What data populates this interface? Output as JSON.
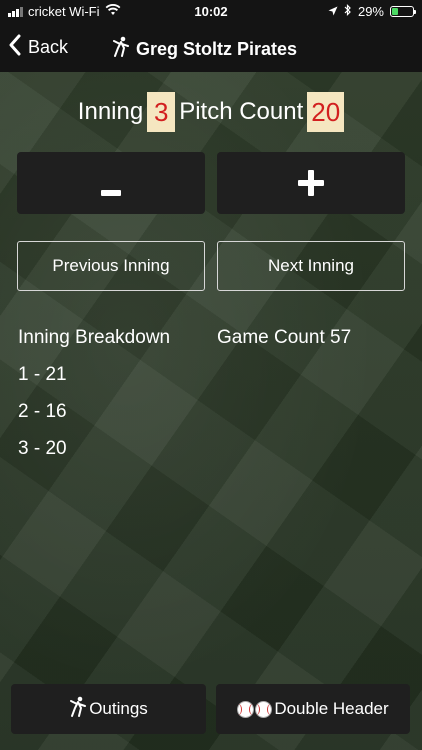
{
  "status_bar": {
    "carrier": "cricket Wi-Fi",
    "time": "10:02",
    "battery": "29%",
    "battery_fraction": 0.29,
    "icons": [
      "signal-bars-icon",
      "wifi-icon",
      "location-icon",
      "bluetooth-icon",
      "battery-icon"
    ]
  },
  "nav": {
    "back_label": "Back",
    "title": "Greg Stoltz Pirates",
    "title_icon": "pitcher-icon"
  },
  "counter": {
    "inning_label": "Inning",
    "inning_value": "3",
    "pitch_count_label": "Pitch Count",
    "pitch_count_value": "20",
    "value_color": "#d21f1f",
    "value_bg": "#f5e6c0"
  },
  "steppers": {
    "minus_label": "-",
    "plus_label": "+"
  },
  "inning_nav": {
    "previous_label": "Previous Inning",
    "next_label": "Next Inning"
  },
  "breakdown": {
    "label": "Inning Breakdown",
    "game_count": "Game Count 57",
    "items": [
      "1 - 21",
      "2 - 16",
      "3 - 20"
    ]
  },
  "footer": {
    "outings_label": "Outings",
    "outings_icon": "pitcher-icon",
    "double_header_label": "Double Header",
    "double_header_icon": "baseballs-icon"
  },
  "colors": {
    "header_bg": "#141414",
    "button_bg": "#1f1f1f",
    "field_green": "#2a3826"
  }
}
